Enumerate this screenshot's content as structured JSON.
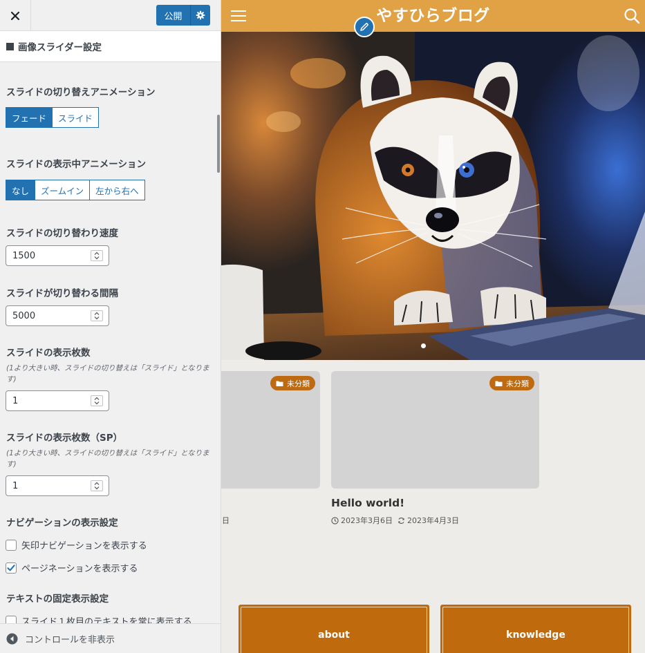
{
  "sidebar": {
    "publish_label": "公開",
    "section_title": "画像スライダー設定",
    "transition_animation": {
      "label": "スライドの切り替えアニメーション",
      "options": [
        "フェード",
        "スライド"
      ],
      "selected": "フェード"
    },
    "display_animation": {
      "label": "スライドの表示中アニメーション",
      "options": [
        "なし",
        "ズームイン",
        "左から右へ"
      ],
      "selected": "なし"
    },
    "speed": {
      "label": "スライドの切り替わり速度",
      "value": "1500"
    },
    "interval": {
      "label": "スライドが切り替わる間隔",
      "value": "5000"
    },
    "slides_count": {
      "label": "スライドの表示枚数",
      "description": "(1より大きい時、スライドの切り替えは「スライド」となります)",
      "value": "1"
    },
    "slides_count_sp": {
      "label": "スライドの表示枚数（SP）",
      "description": "(1より大きい時、スライドの切り替えは「スライド」となります)",
      "value": "1"
    },
    "navigation": {
      "label": "ナビゲーションの表示設定",
      "arrow_label": "矢印ナビゲーションを表示する",
      "arrow_checked": false,
      "pagination_label": "ページネーションを表示する",
      "pagination_checked": true
    },
    "text_fixed": {
      "label": "テキストの固定表示設定",
      "first_slide_label": "スライド１枚目のテキストを常に表示する",
      "first_slide_checked": false
    },
    "footer_label": "コントロールを非表示"
  },
  "preview": {
    "site_title": "やすひらブログ",
    "slider_dots": 1,
    "cards": [
      {
        "category": "未分類",
        "title": "",
        "meta_partial": "日"
      },
      {
        "category": "未分類",
        "title": "Hello world!",
        "published": "2023年3月6日",
        "updated": "2023年4月3日"
      }
    ],
    "nav_boxes": [
      "about",
      "knowledge"
    ]
  },
  "colors": {
    "accent": "#2271b1",
    "header": "#e0a245",
    "badge": "#bd6a10",
    "nav_box": "#c06a0e"
  },
  "icons": [
    "close-icon",
    "gear-icon",
    "hamburger-icon",
    "search-icon",
    "pencil-icon",
    "folder-icon",
    "clock-icon",
    "refresh-icon",
    "check-icon",
    "collapse-icon",
    "spin-arrows-icon"
  ]
}
